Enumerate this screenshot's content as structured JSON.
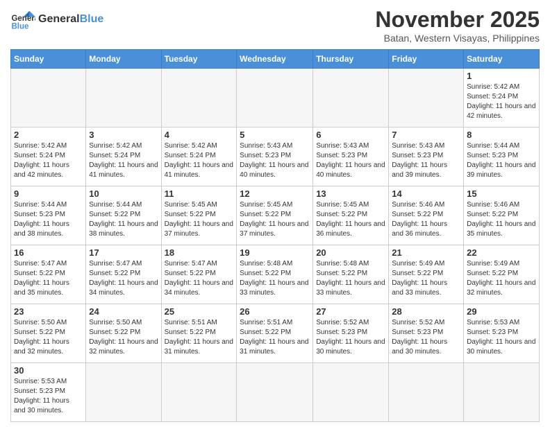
{
  "logo": {
    "text_general": "General",
    "text_blue": "Blue"
  },
  "header": {
    "month": "November 2025",
    "location": "Batan, Western Visayas, Philippines"
  },
  "weekdays": [
    "Sunday",
    "Monday",
    "Tuesday",
    "Wednesday",
    "Thursday",
    "Friday",
    "Saturday"
  ],
  "weeks": [
    [
      {
        "day": "",
        "empty": true
      },
      {
        "day": "",
        "empty": true
      },
      {
        "day": "",
        "empty": true
      },
      {
        "day": "",
        "empty": true
      },
      {
        "day": "",
        "empty": true
      },
      {
        "day": "",
        "empty": true
      },
      {
        "day": "1",
        "sunrise": "5:42 AM",
        "sunset": "5:24 PM",
        "daylight": "11 hours and 42 minutes."
      }
    ],
    [
      {
        "day": "2",
        "sunrise": "5:42 AM",
        "sunset": "5:24 PM",
        "daylight": "11 hours and 42 minutes."
      },
      {
        "day": "3",
        "sunrise": "5:42 AM",
        "sunset": "5:24 PM",
        "daylight": "11 hours and 41 minutes."
      },
      {
        "day": "4",
        "sunrise": "5:42 AM",
        "sunset": "5:24 PM",
        "daylight": "11 hours and 41 minutes."
      },
      {
        "day": "5",
        "sunrise": "5:43 AM",
        "sunset": "5:23 PM",
        "daylight": "11 hours and 40 minutes."
      },
      {
        "day": "6",
        "sunrise": "5:43 AM",
        "sunset": "5:23 PM",
        "daylight": "11 hours and 40 minutes."
      },
      {
        "day": "7",
        "sunrise": "5:43 AM",
        "sunset": "5:23 PM",
        "daylight": "11 hours and 39 minutes."
      },
      {
        "day": "8",
        "sunrise": "5:44 AM",
        "sunset": "5:23 PM",
        "daylight": "11 hours and 39 minutes."
      }
    ],
    [
      {
        "day": "9",
        "sunrise": "5:44 AM",
        "sunset": "5:23 PM",
        "daylight": "11 hours and 38 minutes."
      },
      {
        "day": "10",
        "sunrise": "5:44 AM",
        "sunset": "5:22 PM",
        "daylight": "11 hours and 38 minutes."
      },
      {
        "day": "11",
        "sunrise": "5:45 AM",
        "sunset": "5:22 PM",
        "daylight": "11 hours and 37 minutes."
      },
      {
        "day": "12",
        "sunrise": "5:45 AM",
        "sunset": "5:22 PM",
        "daylight": "11 hours and 37 minutes."
      },
      {
        "day": "13",
        "sunrise": "5:45 AM",
        "sunset": "5:22 PM",
        "daylight": "11 hours and 36 minutes."
      },
      {
        "day": "14",
        "sunrise": "5:46 AM",
        "sunset": "5:22 PM",
        "daylight": "11 hours and 36 minutes."
      },
      {
        "day": "15",
        "sunrise": "5:46 AM",
        "sunset": "5:22 PM",
        "daylight": "11 hours and 35 minutes."
      }
    ],
    [
      {
        "day": "16",
        "sunrise": "5:47 AM",
        "sunset": "5:22 PM",
        "daylight": "11 hours and 35 minutes."
      },
      {
        "day": "17",
        "sunrise": "5:47 AM",
        "sunset": "5:22 PM",
        "daylight": "11 hours and 34 minutes."
      },
      {
        "day": "18",
        "sunrise": "5:47 AM",
        "sunset": "5:22 PM",
        "daylight": "11 hours and 34 minutes."
      },
      {
        "day": "19",
        "sunrise": "5:48 AM",
        "sunset": "5:22 PM",
        "daylight": "11 hours and 33 minutes."
      },
      {
        "day": "20",
        "sunrise": "5:48 AM",
        "sunset": "5:22 PM",
        "daylight": "11 hours and 33 minutes."
      },
      {
        "day": "21",
        "sunrise": "5:49 AM",
        "sunset": "5:22 PM",
        "daylight": "11 hours and 33 minutes."
      },
      {
        "day": "22",
        "sunrise": "5:49 AM",
        "sunset": "5:22 PM",
        "daylight": "11 hours and 32 minutes."
      }
    ],
    [
      {
        "day": "23",
        "sunrise": "5:50 AM",
        "sunset": "5:22 PM",
        "daylight": "11 hours and 32 minutes."
      },
      {
        "day": "24",
        "sunrise": "5:50 AM",
        "sunset": "5:22 PM",
        "daylight": "11 hours and 32 minutes."
      },
      {
        "day": "25",
        "sunrise": "5:51 AM",
        "sunset": "5:22 PM",
        "daylight": "11 hours and 31 minutes."
      },
      {
        "day": "26",
        "sunrise": "5:51 AM",
        "sunset": "5:22 PM",
        "daylight": "11 hours and 31 minutes."
      },
      {
        "day": "27",
        "sunrise": "5:52 AM",
        "sunset": "5:23 PM",
        "daylight": "11 hours and 30 minutes."
      },
      {
        "day": "28",
        "sunrise": "5:52 AM",
        "sunset": "5:23 PM",
        "daylight": "11 hours and 30 minutes."
      },
      {
        "day": "29",
        "sunrise": "5:53 AM",
        "sunset": "5:23 PM",
        "daylight": "11 hours and 30 minutes."
      }
    ],
    [
      {
        "day": "30",
        "sunrise": "5:53 AM",
        "sunset": "5:23 PM",
        "daylight": "11 hours and 30 minutes."
      },
      {
        "day": "",
        "empty": true
      },
      {
        "day": "",
        "empty": true
      },
      {
        "day": "",
        "empty": true
      },
      {
        "day": "",
        "empty": true
      },
      {
        "day": "",
        "empty": true
      },
      {
        "day": "",
        "empty": true
      }
    ]
  ],
  "labels": {
    "sunrise": "Sunrise:",
    "sunset": "Sunset:",
    "daylight": "Daylight:"
  }
}
